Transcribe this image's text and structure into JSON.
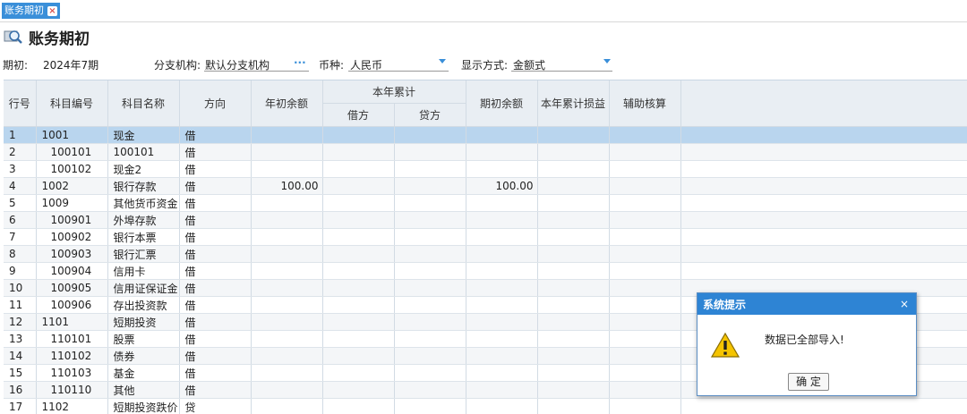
{
  "tab": {
    "label": "账务期初"
  },
  "page_title": "账务期初",
  "filters": {
    "period_label": "期初:",
    "period_value": "2024年7期",
    "branch_label": "分支机构:",
    "branch_value": "默认分支机构",
    "branch_picker": "···",
    "currency_label": "币种:",
    "currency_value": "人民币",
    "display_label": "显示方式:",
    "display_value": "金额式"
  },
  "table": {
    "headers": {
      "row_no": "行号",
      "code": "科目编号",
      "name": "科目名称",
      "direction": "方向",
      "year_open": "年初余额",
      "ytd": "本年累计",
      "debit": "借方",
      "credit": "贷方",
      "period_open": "期初余额",
      "ytd_pl": "本年累计损益",
      "aux": "辅助核算"
    },
    "rows": [
      {
        "no": "1",
        "code": "1001",
        "name": "现金",
        "dir": "借",
        "year_open": "",
        "debit": "",
        "credit": "",
        "period_open": "",
        "level": 1,
        "selected": true
      },
      {
        "no": "2",
        "code": "100101",
        "name": "100101",
        "dir": "借",
        "year_open": "",
        "debit": "",
        "credit": "",
        "period_open": "",
        "level": 2
      },
      {
        "no": "3",
        "code": "100102",
        "name": "现金2",
        "dir": "借",
        "year_open": "",
        "debit": "",
        "credit": "",
        "period_open": "",
        "level": 2
      },
      {
        "no": "4",
        "code": "1002",
        "name": "银行存款",
        "dir": "借",
        "year_open": "100.00",
        "debit": "",
        "credit": "",
        "period_open": "100.00",
        "level": 1
      },
      {
        "no": "5",
        "code": "1009",
        "name": "其他货币资金",
        "dir": "借",
        "year_open": "",
        "debit": "",
        "credit": "",
        "period_open": "",
        "level": 1
      },
      {
        "no": "6",
        "code": "100901",
        "name": "外埠存款",
        "dir": "借",
        "year_open": "",
        "debit": "",
        "credit": "",
        "period_open": "",
        "level": 2
      },
      {
        "no": "7",
        "code": "100902",
        "name": "银行本票",
        "dir": "借",
        "year_open": "",
        "debit": "",
        "credit": "",
        "period_open": "",
        "level": 2
      },
      {
        "no": "8",
        "code": "100903",
        "name": "银行汇票",
        "dir": "借",
        "year_open": "",
        "debit": "",
        "credit": "",
        "period_open": "",
        "level": 2
      },
      {
        "no": "9",
        "code": "100904",
        "name": "信用卡",
        "dir": "借",
        "year_open": "",
        "debit": "",
        "credit": "",
        "period_open": "",
        "level": 2
      },
      {
        "no": "10",
        "code": "100905",
        "name": "信用证保证金",
        "dir": "借",
        "year_open": "",
        "debit": "",
        "credit": "",
        "period_open": "",
        "level": 2
      },
      {
        "no": "11",
        "code": "100906",
        "name": "存出投资款",
        "dir": "借",
        "year_open": "",
        "debit": "",
        "credit": "",
        "period_open": "",
        "level": 2
      },
      {
        "no": "12",
        "code": "1101",
        "name": "短期投资",
        "dir": "借",
        "year_open": "",
        "debit": "",
        "credit": "",
        "period_open": "",
        "level": 1
      },
      {
        "no": "13",
        "code": "110101",
        "name": "股票",
        "dir": "借",
        "year_open": "",
        "debit": "",
        "credit": "",
        "period_open": "",
        "level": 2
      },
      {
        "no": "14",
        "code": "110102",
        "name": "债券",
        "dir": "借",
        "year_open": "",
        "debit": "",
        "credit": "",
        "period_open": "",
        "level": 2
      },
      {
        "no": "15",
        "code": "110103",
        "name": "基金",
        "dir": "借",
        "year_open": "",
        "debit": "",
        "credit": "",
        "period_open": "",
        "level": 2
      },
      {
        "no": "16",
        "code": "110110",
        "name": "其他",
        "dir": "借",
        "year_open": "",
        "debit": "",
        "credit": "",
        "period_open": "",
        "level": 2
      },
      {
        "no": "17",
        "code": "1102",
        "name": "短期投资跌价",
        "dir": "贷",
        "year_open": "",
        "debit": "",
        "credit": "",
        "period_open": "",
        "level": 1
      }
    ]
  },
  "dialog": {
    "title": "系统提示",
    "close": "×",
    "message": "数据已全部导入!",
    "ok_label": "确 定"
  },
  "colors": {
    "accent": "#2e84d4",
    "selected_row": "#b9d5ee",
    "header_bg": "#e9eef3"
  }
}
